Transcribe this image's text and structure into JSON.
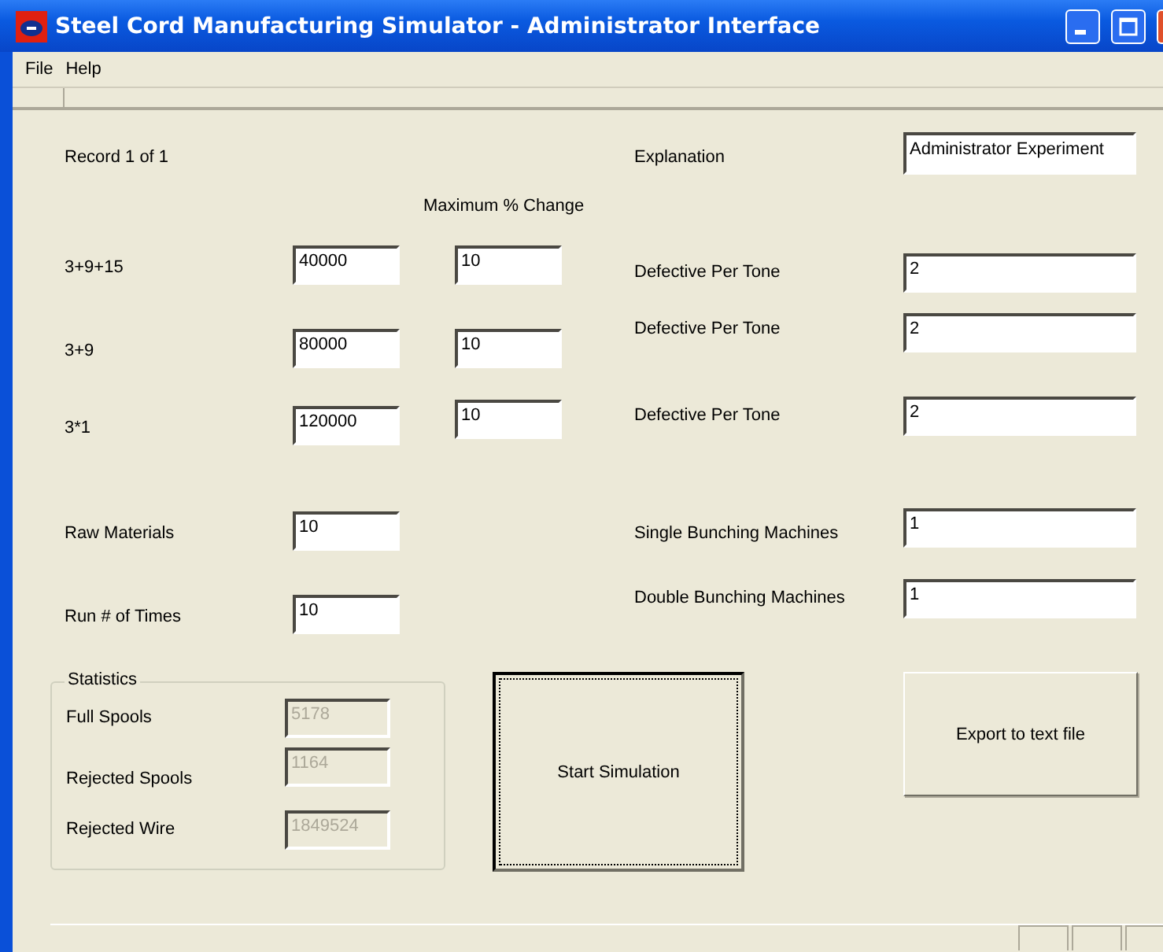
{
  "window": {
    "title": "Steel Cord Manufacturing Simulator - Administrator Interface"
  },
  "menu": [
    "File",
    "Help"
  ],
  "record_label": "Record 1 of 1",
  "percent_header": "Maximum % Change",
  "products": [
    {
      "label": "3+9+15",
      "quantity": "40000",
      "max_change": "10"
    },
    {
      "label": "3+9",
      "quantity": "80000",
      "max_change": "10"
    },
    {
      "label": "3*1",
      "quantity": "120000",
      "max_change": "10"
    }
  ],
  "inputs": [
    {
      "label": "Raw Materials",
      "value": "10"
    },
    {
      "label": "Run # of Times",
      "value": "10"
    }
  ],
  "explanation": {
    "label": "Explanation",
    "value": "Administrator Experiment"
  },
  "defects": [
    {
      "label": "Defective Per Tone",
      "value": "2"
    },
    {
      "label": "Defective Per Tone",
      "value": "2"
    },
    {
      "label": "Defective Per Tone",
      "value": "2"
    }
  ],
  "machines": [
    {
      "label": "Single Bunching Machines",
      "value": "1"
    },
    {
      "label": "Double Bunching Machines",
      "value": "1"
    }
  ],
  "statistics": {
    "title": "Statistics",
    "rows": [
      {
        "label": "Full Spools",
        "value": "5178",
        "disabled": true
      },
      {
        "label": "Rejected Spools",
        "value": "1164",
        "disabled": true
      },
      {
        "label": "Rejected Wire",
        "value": "1849524",
        "disabled": true
      }
    ]
  },
  "buttons": [
    {
      "label": "Start Simulation",
      "focused": true
    },
    {
      "label": "Export to text file",
      "focused": false
    }
  ]
}
